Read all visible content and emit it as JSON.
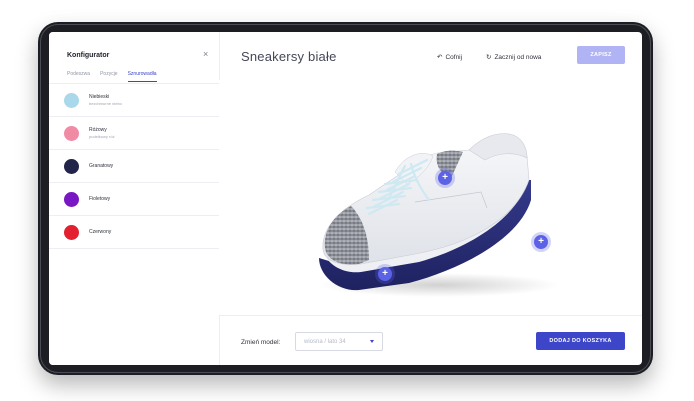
{
  "sidebar": {
    "title": "Konfigurator",
    "close_icon": "×",
    "tabs": [
      {
        "label": "Podeszwa",
        "active": false
      },
      {
        "label": "Pozycje",
        "active": false
      },
      {
        "label": "Sznurowadła",
        "active": true
      }
    ],
    "options": [
      {
        "name": "Niebieski",
        "sub": "bezchmurne niebo",
        "color": "#a8d8ea"
      },
      {
        "name": "Różowy",
        "sub": "pudełkowy róż",
        "color": "#f08aa5"
      },
      {
        "name": "Granatowy",
        "sub": "",
        "color": "#22244a"
      },
      {
        "name": "Fioletowy",
        "sub": "",
        "color": "#7a17c4"
      },
      {
        "name": "Czerwony",
        "sub": "",
        "color": "#e3202f"
      }
    ]
  },
  "header": {
    "title": "Sneakersy białe",
    "undo_icon": "↶",
    "undo_label": "Cofnij",
    "restart_icon": "↻",
    "restart_label": "Zacznij od nowa",
    "save_label": "ZAPISZ"
  },
  "canvas": {
    "hotspot_label": "+"
  },
  "footer": {
    "model_label": "Zmień model:",
    "model_value": "wiosna / lato 34",
    "cart_label": "DODAJ DO KOSZYKA"
  },
  "colors": {
    "accent": "#3d45c8",
    "save_disabled": "#b0b4f4",
    "sole": "#2a2f7a"
  }
}
